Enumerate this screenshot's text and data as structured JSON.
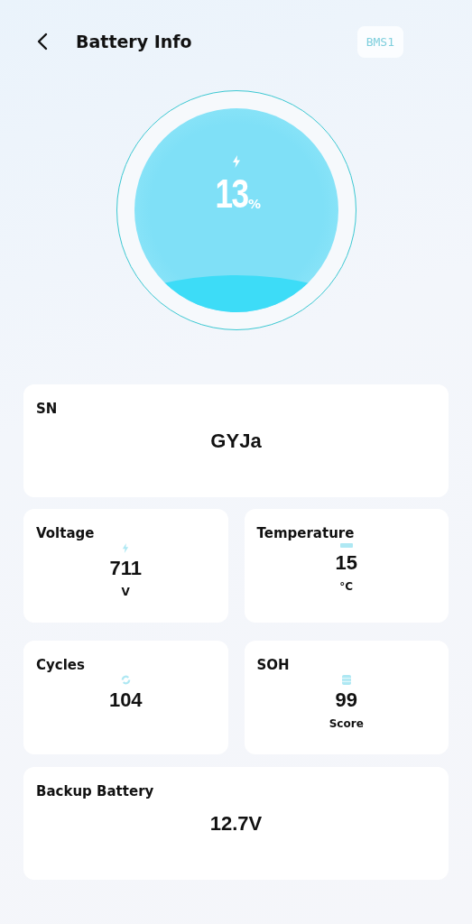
{
  "header": {
    "title": "Battery Info",
    "device_badge": "BMS1"
  },
  "battery": {
    "percent": "13",
    "unit": "%"
  },
  "sn": {
    "label": "SN",
    "value": "GYJa"
  },
  "stats": [
    {
      "kind": "voltage",
      "label": "Voltage",
      "value": "711",
      "unit": "V"
    },
    {
      "kind": "temperature",
      "label": "Temperature",
      "value": "15",
      "unit": "°C"
    },
    {
      "kind": "cycles",
      "label": "Cycles",
      "value": "104"
    },
    {
      "kind": "soh",
      "label": "SOH",
      "value": "99",
      "unit": "Score"
    }
  ],
  "backup": {
    "label": "Backup Battery",
    "value": "12.7V"
  }
}
